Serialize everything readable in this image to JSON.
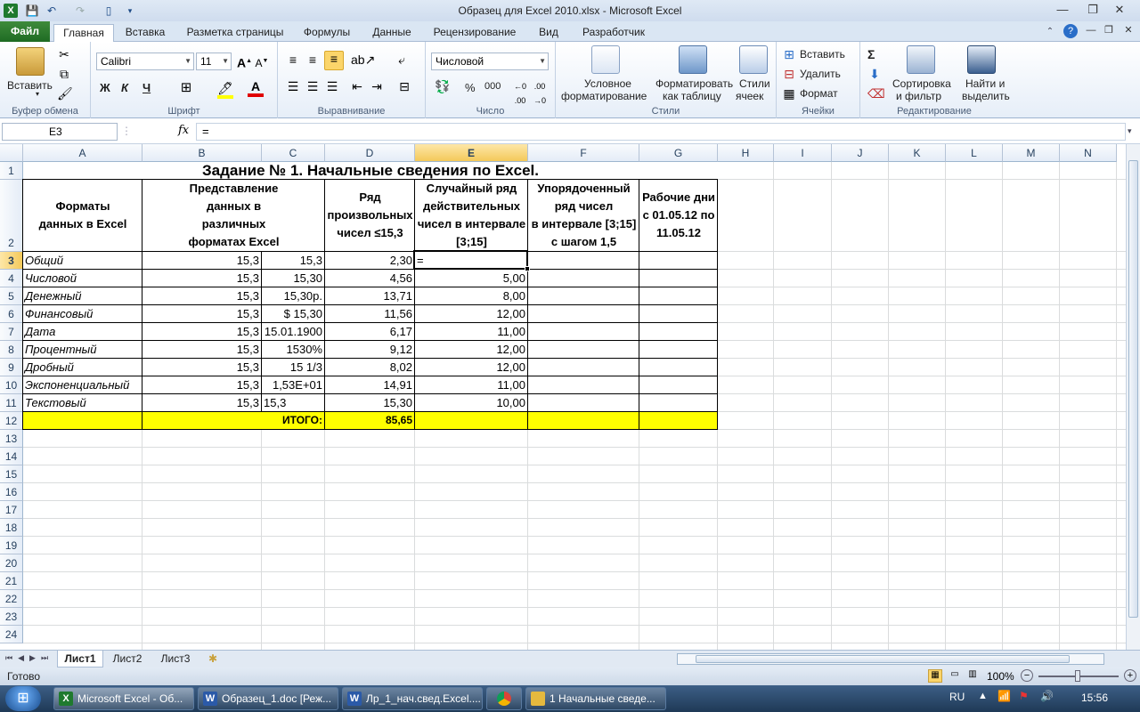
{
  "window": {
    "title": "Образец для Excel 2010.xlsx  -  Microsoft Excel",
    "min": "—",
    "max": "❐",
    "close": "✕"
  },
  "ribbon_tabs": [
    "Файл",
    "Главная",
    "Вставка",
    "Разметка страницы",
    "Формулы",
    "Данные",
    "Рецензирование",
    "Вид",
    "Разработчик"
  ],
  "clipboard": {
    "paste": "Вставить",
    "label": "Буфер обмена"
  },
  "font": {
    "name": "Calibri",
    "size": "11",
    "bold": "Ж",
    "italic": "К",
    "underline": "Ч",
    "label": "Шрифт"
  },
  "alignment": {
    "label": "Выравнивание"
  },
  "number": {
    "format": "Числовой",
    "percent": "%",
    "thousands": "000",
    "label": "Число"
  },
  "styles": {
    "conditional": [
      "Условное",
      "форматирование"
    ],
    "table": [
      "Форматировать",
      "как таблицу"
    ],
    "cell": [
      "Стили",
      "ячеек"
    ],
    "label": "Стили"
  },
  "cells": {
    "insert": "Вставить",
    "delete": "Удалить",
    "format": "Формат",
    "label": "Ячейки"
  },
  "editing": {
    "sort": [
      "Сортировка",
      "и фильтр"
    ],
    "find": [
      "Найти и",
      "выделить"
    ],
    "label": "Редактирование",
    "sigma": "Σ"
  },
  "formula_bar": {
    "namebox": "E3",
    "fx": "fx",
    "formula": "="
  },
  "columns": [
    "A",
    "B",
    "C",
    "D",
    "E",
    "F",
    "G",
    "H",
    "I",
    "J",
    "K",
    "L",
    "M",
    "N"
  ],
  "rows": [
    "1",
    "2",
    "3",
    "4",
    "5",
    "6",
    "7",
    "8",
    "9",
    "10",
    "11",
    "12",
    "13",
    "14",
    "15",
    "16",
    "17",
    "18",
    "19",
    "20",
    "21",
    "22",
    "23",
    "24"
  ],
  "sheet": {
    "title": "Задание № 1. Начальные сведения по Excel.",
    "headers": {
      "a": [
        "Форматы",
        "данных в Excel"
      ],
      "bc": [
        "Представление",
        "данных в",
        "различных",
        "форматах Excel"
      ],
      "d": [
        "Ряд",
        "произвольных",
        "чисел ≤15,3"
      ],
      "e": [
        "Случайный ряд",
        "действительных",
        "чисел в интервале",
        "[3;15]"
      ],
      "f": [
        "Упорядоченный",
        "ряд чисел",
        "в интервале [3;15]",
        "с шагом 1,5"
      ],
      "g": [
        "Рабочие дни",
        "с 01.05.12 по",
        "11.05.12"
      ]
    },
    "rows": [
      {
        "a": "Общий",
        "b": "15,3",
        "c": "15,3",
        "d": "2,30",
        "e": "="
      },
      {
        "a": "Числовой",
        "b": "15,3",
        "c": "15,30",
        "d": "4,56",
        "e": "5,00"
      },
      {
        "a": "Денежный",
        "b": "15,3",
        "c": "15,30р.",
        "d": "13,71",
        "e": "8,00"
      },
      {
        "a": "Финансовый",
        "b": "15,3",
        "c": "$    15,30",
        "d": "11,56",
        "e": "12,00"
      },
      {
        "a": "Дата",
        "b": "15,3",
        "c": "15.01.1900",
        "d": "6,17",
        "e": "11,00"
      },
      {
        "a": "Процентный",
        "b": "15,3",
        "c": "1530%",
        "d": "9,12",
        "e": "12,00"
      },
      {
        "a": "Дробный",
        "b": "15,3",
        "c": "15 1/3",
        "d": "8,02",
        "e": "12,00"
      },
      {
        "a": "Экспоненциальный",
        "b": "15,3",
        "c": "1,53E+01",
        "d": "14,91",
        "e": "11,00"
      },
      {
        "a": "Текстовый",
        "b": "15,3",
        "c": "15,3",
        "d": "15,30",
        "e": "10,00"
      }
    ],
    "total_label": "ИТОГО:",
    "total_value": "85,65"
  },
  "sheet_tabs": [
    "Лист1",
    "Лист2",
    "Лист3"
  ],
  "status": {
    "ready": "Готово",
    "zoom": "100%"
  },
  "taskbar": {
    "items": [
      "Microsoft Excel - Об...",
      "Образец_1.doc [Реж...",
      "Лр_1_нач.свед.Excel....",
      "",
      "1 Начальные сведе..."
    ],
    "lang": "RU",
    "time": "15:56"
  },
  "colors": {
    "total_fill": "#ffff00",
    "active_cell": "#000000",
    "file_tab": "#2a7a2a"
  }
}
